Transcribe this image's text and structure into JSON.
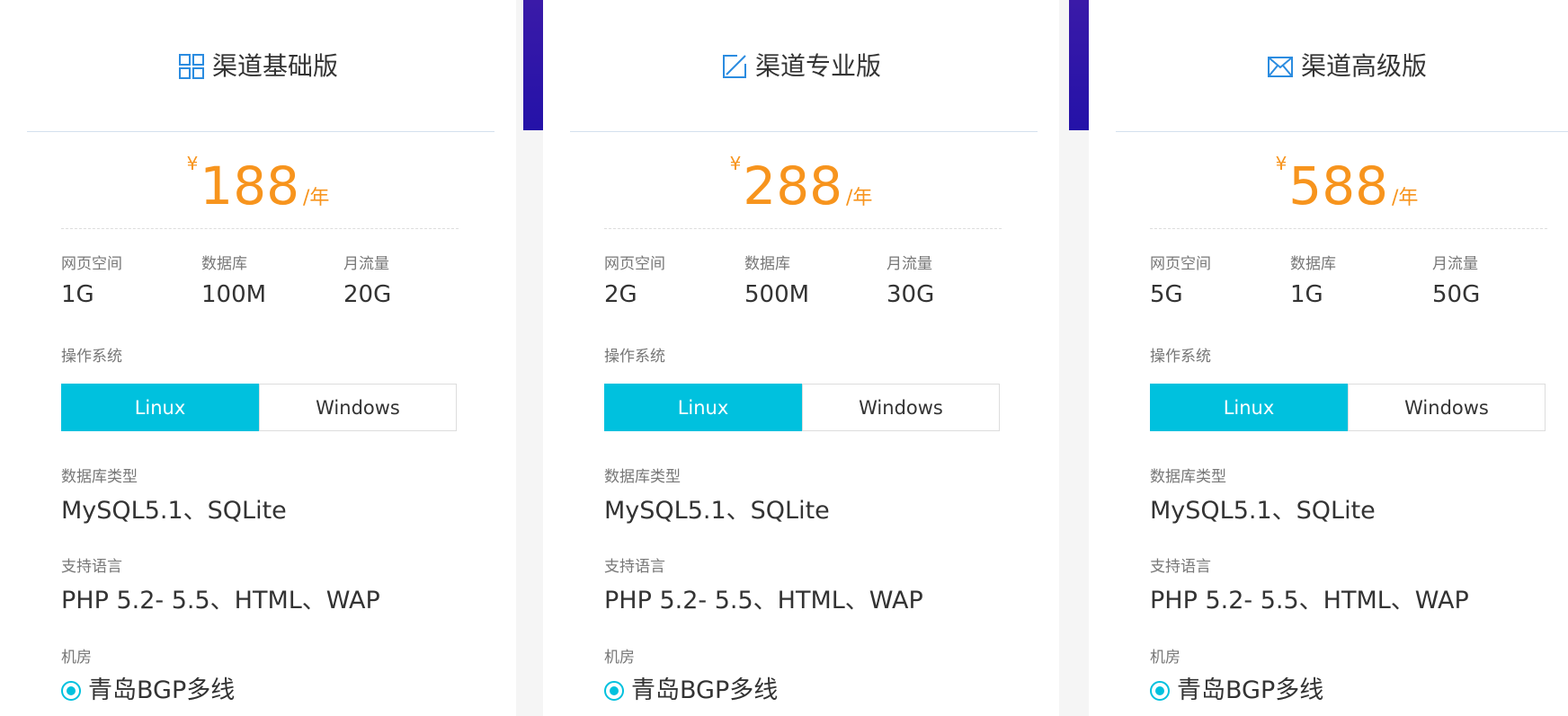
{
  "colors": {
    "accent_price": "#f7941d",
    "selected": "#00c1de",
    "icon": "#2b8ce0",
    "divider": "#2412a8"
  },
  "labels": {
    "web_space": "网页空间",
    "database": "数据库",
    "monthly_traffic": "月流量",
    "os": "操作系统",
    "db_type": "数据库类型",
    "languages": "支持语言",
    "datacenter": "机房"
  },
  "plans": [
    {
      "icon": "grid-icon",
      "name": "渠道基础版",
      "currency": "¥",
      "price": "188",
      "unit": "/年",
      "web_space": "1G",
      "database": "100M",
      "monthly_traffic": "20G",
      "os_options": [
        "Linux",
        "Windows"
      ],
      "os_selected": "Linux",
      "db_type": "MySQL5.1、SQLite",
      "languages": "PHP 5.2- 5.5、HTML、WAP",
      "datacenter": "青岛BGP多线"
    },
    {
      "icon": "edit-square-icon",
      "name": "渠道专业版",
      "currency": "¥",
      "price": "288",
      "unit": "/年",
      "web_space": "2G",
      "database": "500M",
      "monthly_traffic": "30G",
      "os_options": [
        "Linux",
        "Windows"
      ],
      "os_selected": "Linux",
      "db_type": "MySQL5.1、SQLite",
      "languages": "PHP 5.2- 5.5、HTML、WAP",
      "datacenter": "青岛BGP多线"
    },
    {
      "icon": "envelope-x-icon",
      "name": "渠道高级版",
      "currency": "¥",
      "price": "588",
      "unit": "/年",
      "web_space": "5G",
      "database": "1G",
      "monthly_traffic": "50G",
      "os_options": [
        "Linux",
        "Windows"
      ],
      "os_selected": "Linux",
      "db_type": "MySQL5.1、SQLite",
      "languages": "PHP 5.2- 5.5、HTML、WAP",
      "datacenter": "青岛BGP多线"
    }
  ]
}
